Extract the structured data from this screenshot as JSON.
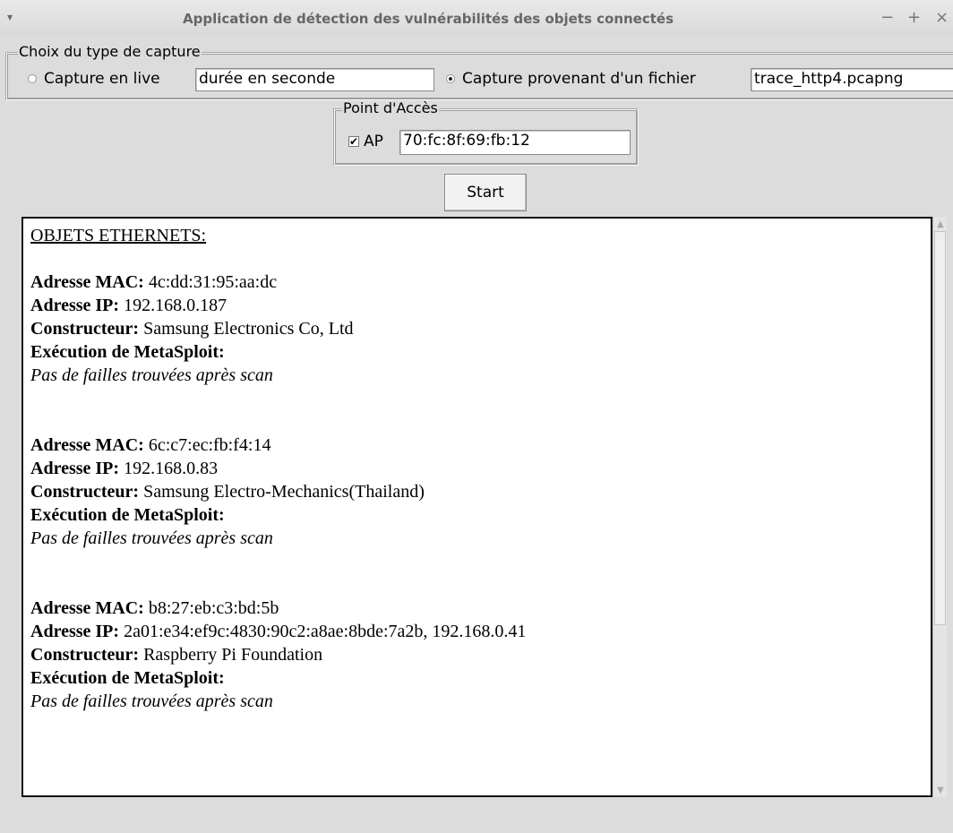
{
  "window": {
    "title": "Application de détection des vulnérabilités des objets connectés",
    "menu_icon": "▾",
    "minimize": "−",
    "maximize": "+",
    "close": "×"
  },
  "capture_group": {
    "legend": "Choix du type de capture",
    "live": {
      "label": "Capture en live",
      "selected": false,
      "duration_value": "durée en seconde"
    },
    "file": {
      "label": "Capture provenant d'un fichier",
      "selected": true,
      "file_value": "trace_http4.pcapng"
    }
  },
  "ap_group": {
    "legend": "Point d'Accès",
    "checkbox_label": "AP",
    "checked": true,
    "check_mark": "✔",
    "mac_value": "70:fc:8f:69:fb:12"
  },
  "start_button": "Start",
  "output": {
    "heading": "OBJETS ETHERNETS:",
    "labels": {
      "mac": "Adresse MAC:",
      "ip": "Adresse IP:",
      "vendor": "Constructeur:",
      "metasploit": "Exécution de MetaSploit:"
    },
    "devices": [
      {
        "mac": "4c:dd:31:95:aa:dc",
        "ip": "192.168.0.187",
        "vendor": "Samsung Electronics Co, Ltd",
        "result": "Pas de failles trouvées après scan"
      },
      {
        "mac": "6c:c7:ec:fb:f4:14",
        "ip": "192.168.0.83",
        "vendor": "Samsung Electro-Mechanics(Thailand)",
        "result": "Pas de failles trouvées après scan"
      },
      {
        "mac": "b8:27:eb:c3:bd:5b",
        "ip": "2a01:e34:ef9c:4830:90c2:a8ae:8bde:7a2b, 192.168.0.41",
        "vendor": "Raspberry Pi Foundation",
        "result": "Pas de failles trouvées après scan"
      }
    ]
  },
  "colors": {
    "window_bg": "#dcdcdc",
    "text_bg": "#ffffff"
  }
}
